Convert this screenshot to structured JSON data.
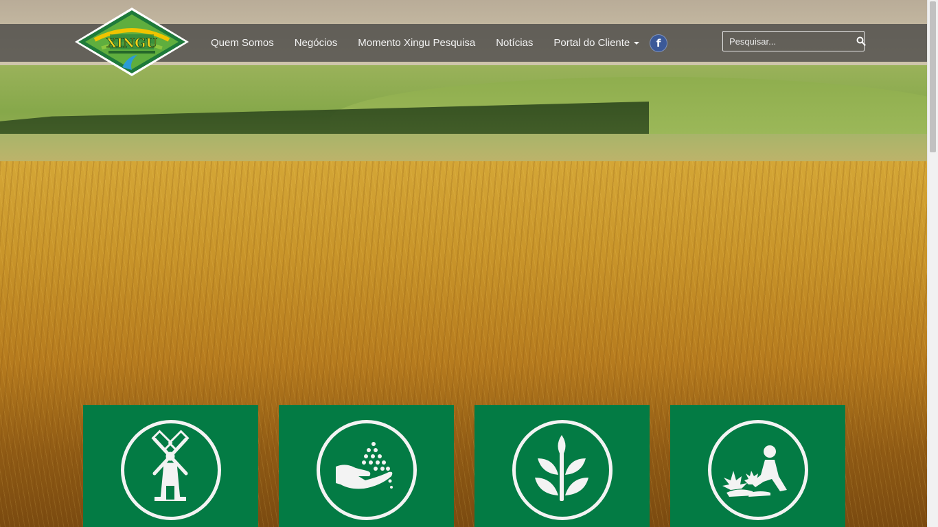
{
  "logo": {
    "text": "XINGU",
    "alt_icon": "xingu-logo"
  },
  "nav": {
    "items": [
      {
        "label": "Quem Somos"
      },
      {
        "label": "Negócios"
      },
      {
        "label": "Momento Xingu Pesquisa"
      },
      {
        "label": "Notícias"
      },
      {
        "label": "Portal do Cliente",
        "has_dropdown": true
      }
    ],
    "social": {
      "icon": "facebook-icon",
      "glyph": "f"
    }
  },
  "search": {
    "placeholder": "Pesquisar...",
    "value": "",
    "icon": "search-icon"
  },
  "tiles": [
    {
      "icon": "windmill-icon"
    },
    {
      "icon": "hand-seeds-icon"
    },
    {
      "icon": "plant-sprout-icon"
    },
    {
      "icon": "person-planting-icon"
    }
  ],
  "colors": {
    "tile_green": "#037b44",
    "nav_overlay": "rgba(60,60,60,.72)",
    "facebook": "#3b5998"
  }
}
